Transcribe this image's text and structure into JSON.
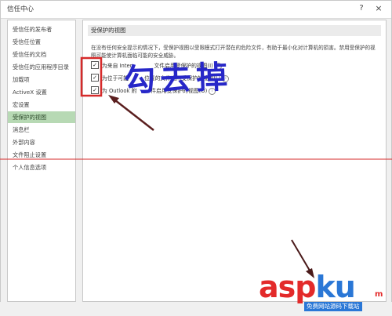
{
  "window": {
    "title": "信任中心",
    "help_icon": "?",
    "close_icon": "×"
  },
  "sidebar": {
    "items": [
      {
        "label": "受信任的发布者",
        "active": false
      },
      {
        "label": "受信任位置",
        "active": false
      },
      {
        "label": "受信任的文档",
        "active": false
      },
      {
        "label": "受信任的应用程序目录",
        "active": false
      },
      {
        "label": "加载项",
        "active": false
      },
      {
        "label": "ActiveX 设置",
        "active": false
      },
      {
        "label": "宏设置",
        "active": false
      },
      {
        "label": "受保护的视图",
        "active": true
      },
      {
        "label": "消息栏",
        "active": false
      },
      {
        "label": "外部内容",
        "active": false
      },
      {
        "label": "文件阻止设置",
        "active": false
      },
      {
        "label": "个人信息选项",
        "active": false
      }
    ]
  },
  "main": {
    "section_title": "受保护的视图",
    "description": "在没有任何安全提示的情况下，受保护视图以受限模式打开潜在的危险文件，有助于最小化对计算机的损害。禁用受保护的视图可能使计算机面临可能的安全威胁。",
    "options": [
      {
        "label": "为来自 Inter",
        "label_tail": "文件启用受保护的视图(I)",
        "checked": true
      },
      {
        "label": "为位于可能",
        "label_tail": "位置的文件启用受保护的视图(L)",
        "checked": true
      },
      {
        "label": "为 Outlook 附",
        "label_tail": "件启用受保护的视图(O)",
        "checked": true
      }
    ]
  },
  "annotations": {
    "handwriting": "勾去掉",
    "markup_color": "#d62a2a",
    "handwriting_color": "#2727c8"
  },
  "watermark": {
    "asp": "asp",
    "ku": "ku",
    "suffix": "m",
    "sub": "免费网站源码下载站"
  }
}
